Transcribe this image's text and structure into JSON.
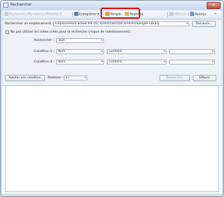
{
  "window": {
    "title": "Rechercher",
    "close_glyph": "✕"
  },
  "toolbar": {
    "search_replace": "Rechercher/Remplacer/Modifier",
    "save": "Enregistrer",
    "simple": "Simple",
    "advanced": "Avancée",
    "display": "Afficher",
    "preview": "Aperçu"
  },
  "search_location": {
    "label": "Rechercher un emplacement :",
    "value": "Emplacement actuel file:///C:/Users/user/Documents/Sample Library",
    "browse": "Parcourir..."
  },
  "index_option": {
    "label": "Ne pas utiliser les index créés pour la recherche (risque de ralentissement)"
  },
  "search_target": {
    "label": "Rechercher :",
    "value": "Tout"
  },
  "conditions": [
    {
      "label": "Condition 1 :",
      "field": "Nom",
      "operator": "Contient",
      "value": "",
      "extra": ""
    },
    {
      "label": "Condition 2 :",
      "field": "Nom",
      "operator": "Contient",
      "value": "",
      "extra": ""
    }
  ],
  "actions": {
    "add_condition": "Ajouter une condition",
    "relation_label": "Relation :",
    "relation_value": "ET",
    "search": "Rechercher",
    "clear": "Effacer"
  },
  "colors": {
    "highlight": "#e00d0d",
    "window_frame": "#cfdcec"
  }
}
